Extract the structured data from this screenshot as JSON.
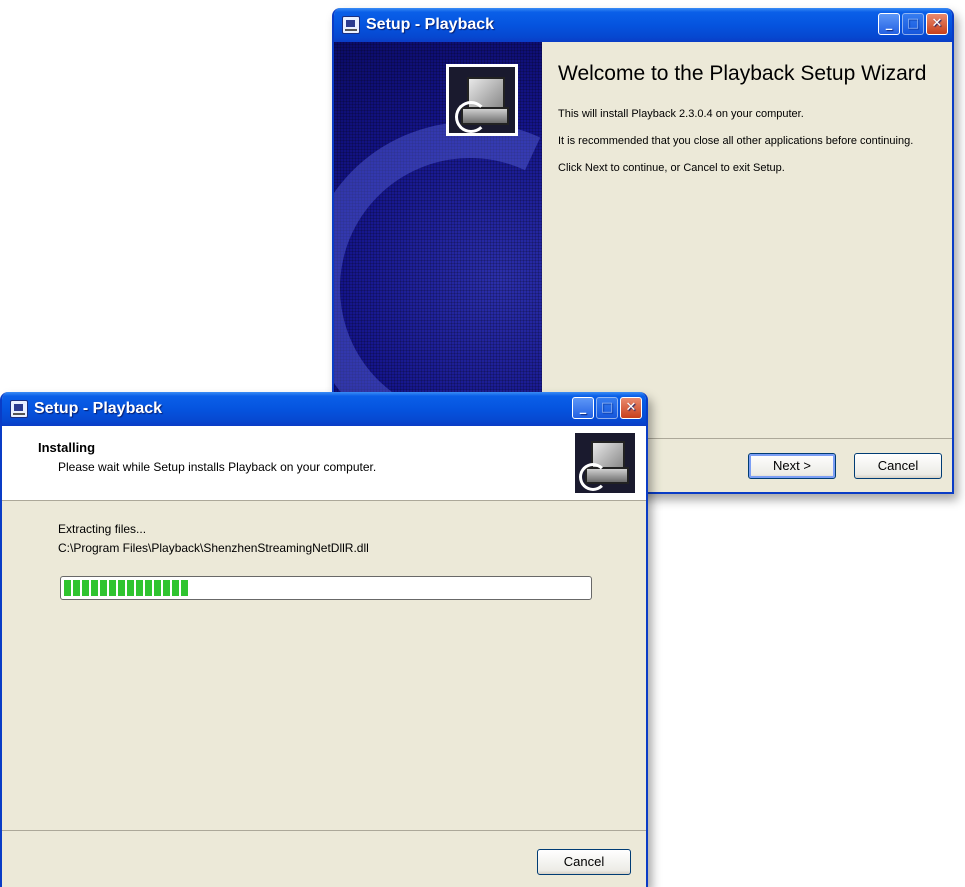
{
  "back_window": {
    "title": "Setup - Playback",
    "heading": "Welcome to the Playback Setup Wizard",
    "paragraphs": [
      "This will install Playback 2.3.0.4 on your computer.",
      "It is recommended that you close all other applications before continuing.",
      "Click Next to continue, or Cancel to exit Setup."
    ],
    "next_label": "Next >",
    "cancel_label": "Cancel"
  },
  "front_window": {
    "title": "Setup - Playback",
    "header_title": "Installing",
    "header_subtitle": "Please wait while Setup installs Playback on your computer.",
    "status_text": "Extracting files...",
    "current_file": "C:\\Program Files\\Playback\\ShenzhenStreamingNetDllR.dll",
    "progress_percent": 24,
    "cancel_label": "Cancel"
  },
  "titlebar_buttons": {
    "minimize_glyph": "_",
    "maximize_glyph": "□",
    "close_glyph": "✕"
  },
  "colors": {
    "titlebar_blue": "#0554df",
    "wizard_panel_blue": "#14148a",
    "progress_green": "#2fc42f",
    "window_face": "#ece9d8"
  }
}
